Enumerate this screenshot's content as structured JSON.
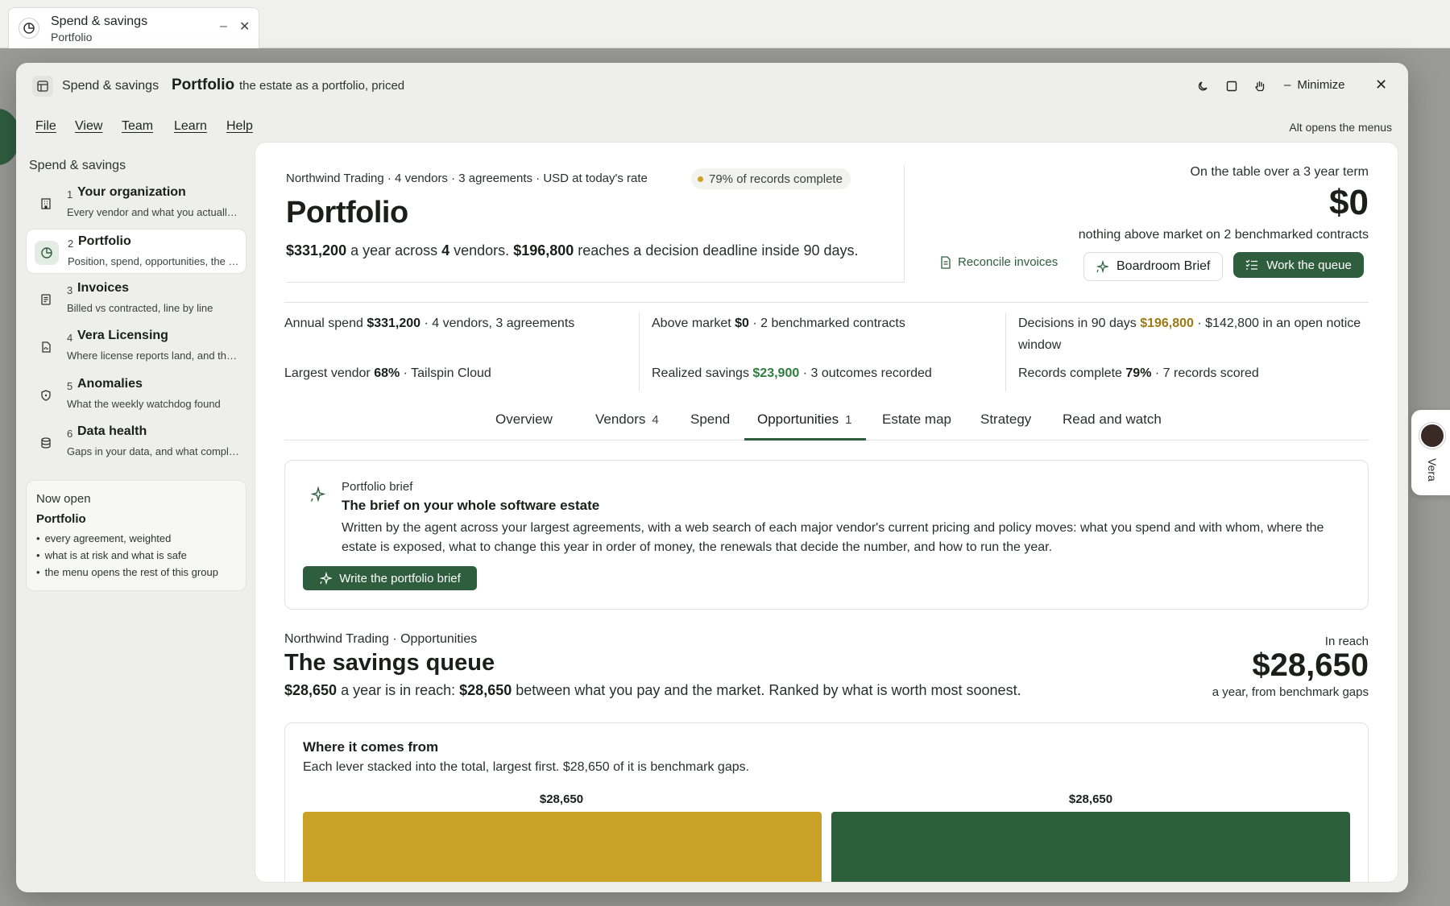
{
  "os_tab": {
    "title": "Spend & savings",
    "subtitle": "Portfolio",
    "minimize": "–",
    "close": "✕"
  },
  "titlebar": {
    "crumb_group": "Spend & savings",
    "crumb_page": "Portfolio",
    "tagline": "the estate as a portfolio, priced",
    "minimize_label": "Minimize",
    "icons": [
      "moon-icon",
      "square-icon",
      "hand-icon"
    ]
  },
  "menu": {
    "items": [
      "File",
      "View",
      "Team",
      "Learn",
      "Help"
    ],
    "hint": "Alt opens the menus"
  },
  "sidebar": {
    "heading": "Spend & savings",
    "items": [
      {
        "num": "1",
        "label": "Your organization",
        "desc": "Every vendor and what you actually pay",
        "icon": "building-icon"
      },
      {
        "num": "2",
        "label": "Portfolio",
        "desc": "Position, spend, opportunities, the estate",
        "icon": "pie-chart-icon"
      },
      {
        "num": "3",
        "label": "Invoices",
        "desc": "Billed vs contracted, line by line",
        "icon": "document-icon"
      },
      {
        "num": "4",
        "label": "Vera Licensing",
        "desc": "Where license reports land, and their status",
        "icon": "file-sync-icon"
      },
      {
        "num": "5",
        "label": "Anomalies",
        "desc": "What the weekly watchdog found",
        "icon": "shield-icon"
      },
      {
        "num": "6",
        "label": "Data health",
        "desc": "Gaps in your data, and what completes them",
        "icon": "database-icon"
      }
    ],
    "now_open": {
      "heading": "Now open",
      "page": "Portfolio",
      "bullets": [
        "every agreement, weighted",
        "what is at risk and what is safe",
        "the menu opens the rest of this group"
      ]
    }
  },
  "header": {
    "meta": "Northwind Trading · 4 vendors · 3 agreements · USD at today's rate",
    "pill": "79% of records complete",
    "title": "Portfolio",
    "sub_a": "$331,200",
    "sub_b": " a year across ",
    "sub_c": "4",
    "sub_d": " vendors. ",
    "sub_e": "$196,800",
    "sub_f": " reaches a decision deadline inside 90 days.",
    "right_label": "On the table over a 3 year term",
    "right_value": "$0",
    "right_note": "nothing above market on 2 benchmarked contracts",
    "btn_reconcile": "Reconcile invoices",
    "btn_brief": "Boardroom Brief",
    "btn_queue": "Work the queue"
  },
  "stats": {
    "annual_lbl": "Annual spend ",
    "annual_val": "$331,200",
    "annual_rest": " · 4 vendors, 3 agreements",
    "largest_lbl": "Largest vendor ",
    "largest_val": "68%",
    "largest_rest": " · Tailspin Cloud",
    "above_lbl": "Above market ",
    "above_val": "$0",
    "above_rest": " · 2 benchmarked contracts",
    "realized_lbl": "Realized savings ",
    "realized_val": "$23,900",
    "realized_rest": " · 3 outcomes recorded",
    "decisions_lbl": "Decisions in 90 days ",
    "decisions_val": "$196,800",
    "decisions_rest": " · $142,800 in an open notice window",
    "records_lbl": "Records complete ",
    "records_val": "79%",
    "records_rest": " · 7 records scored"
  },
  "tabs": [
    {
      "label": "Overview",
      "count": ""
    },
    {
      "label": "Vendors",
      "count": "4"
    },
    {
      "label": "Spend",
      "count": ""
    },
    {
      "label": "Opportunities",
      "count": "1"
    },
    {
      "label": "Estate map",
      "count": ""
    },
    {
      "label": "Strategy",
      "count": ""
    },
    {
      "label": "Read and watch",
      "count": ""
    }
  ],
  "brief": {
    "kicker": "Portfolio brief",
    "title": "The brief on your whole software estate",
    "desc": "Written by the agent across your largest agreements, with a web search of each major vendor's current pricing and policy moves: what you spend and with whom, where the estate is exposed, what to change this year in order of money, the renewals that decide the number, and how to run the year.",
    "button": "Write the portfolio brief"
  },
  "queue": {
    "kicker": "Northwind Trading · Opportunities",
    "title": "The savings queue",
    "d1": "$28,650",
    "d2": " a year is in reach: ",
    "d3": "$28,650",
    "d4": " between what you pay and the market. Ranked by what is worth most soonest.",
    "reach_label": "In reach",
    "reach_value": "$28,650",
    "reach_note": "a year, from benchmark gaps"
  },
  "comes_from": {
    "title": "Where it comes from",
    "desc": "Each lever stacked into the total, largest first. $28,650 of it is benchmark gaps.",
    "bars": [
      {
        "label": "$28,650",
        "color": "#c9a227"
      },
      {
        "label": "$28,650",
        "color": "#2d5e3c"
      }
    ]
  },
  "vera": {
    "label": "Vera"
  },
  "colors": {
    "accent": "#2e5e3e",
    "gold": "#c9a227",
    "green_text": "#2e7d3e"
  }
}
